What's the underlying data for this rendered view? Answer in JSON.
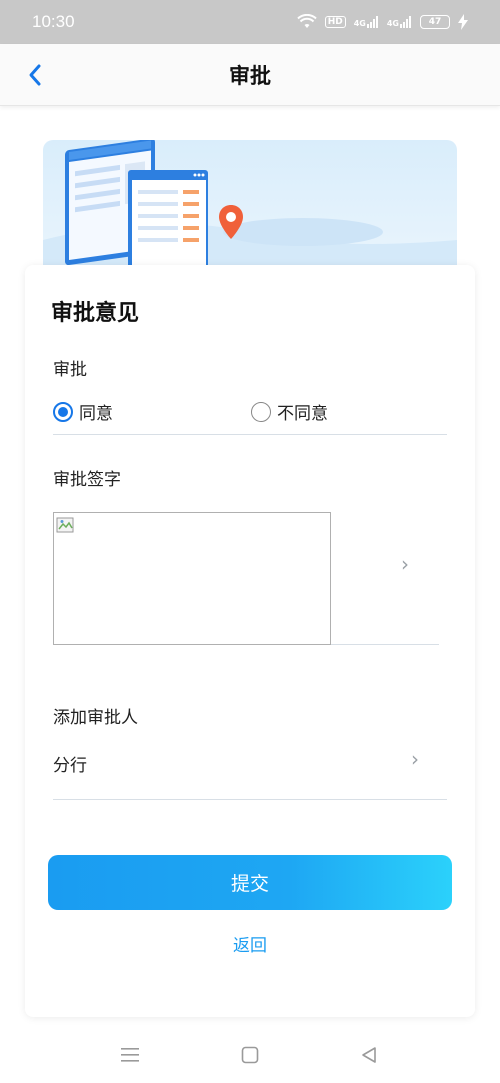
{
  "status_bar": {
    "time": "10:30",
    "hd_label": "HD",
    "signal1_label": "4G",
    "signal2_label": "4G",
    "battery": "47"
  },
  "header": {
    "title": "审批",
    "back_icon": "chevron-left-icon"
  },
  "card": {
    "title": "审批意见",
    "approval": {
      "label": "审批",
      "options": [
        {
          "label": "同意",
          "checked": true
        },
        {
          "label": "不同意",
          "checked": false
        }
      ]
    },
    "signature": {
      "label": "审批签字"
    },
    "add_approver": {
      "label": "添加审批人",
      "value": "分行"
    },
    "submit_label": "提交",
    "return_label": "返回"
  },
  "colors": {
    "accent": "#1677e8",
    "button_start": "#1a9cf1",
    "button_end": "#2bd1fb",
    "status_bar": "#c8c8c8"
  }
}
